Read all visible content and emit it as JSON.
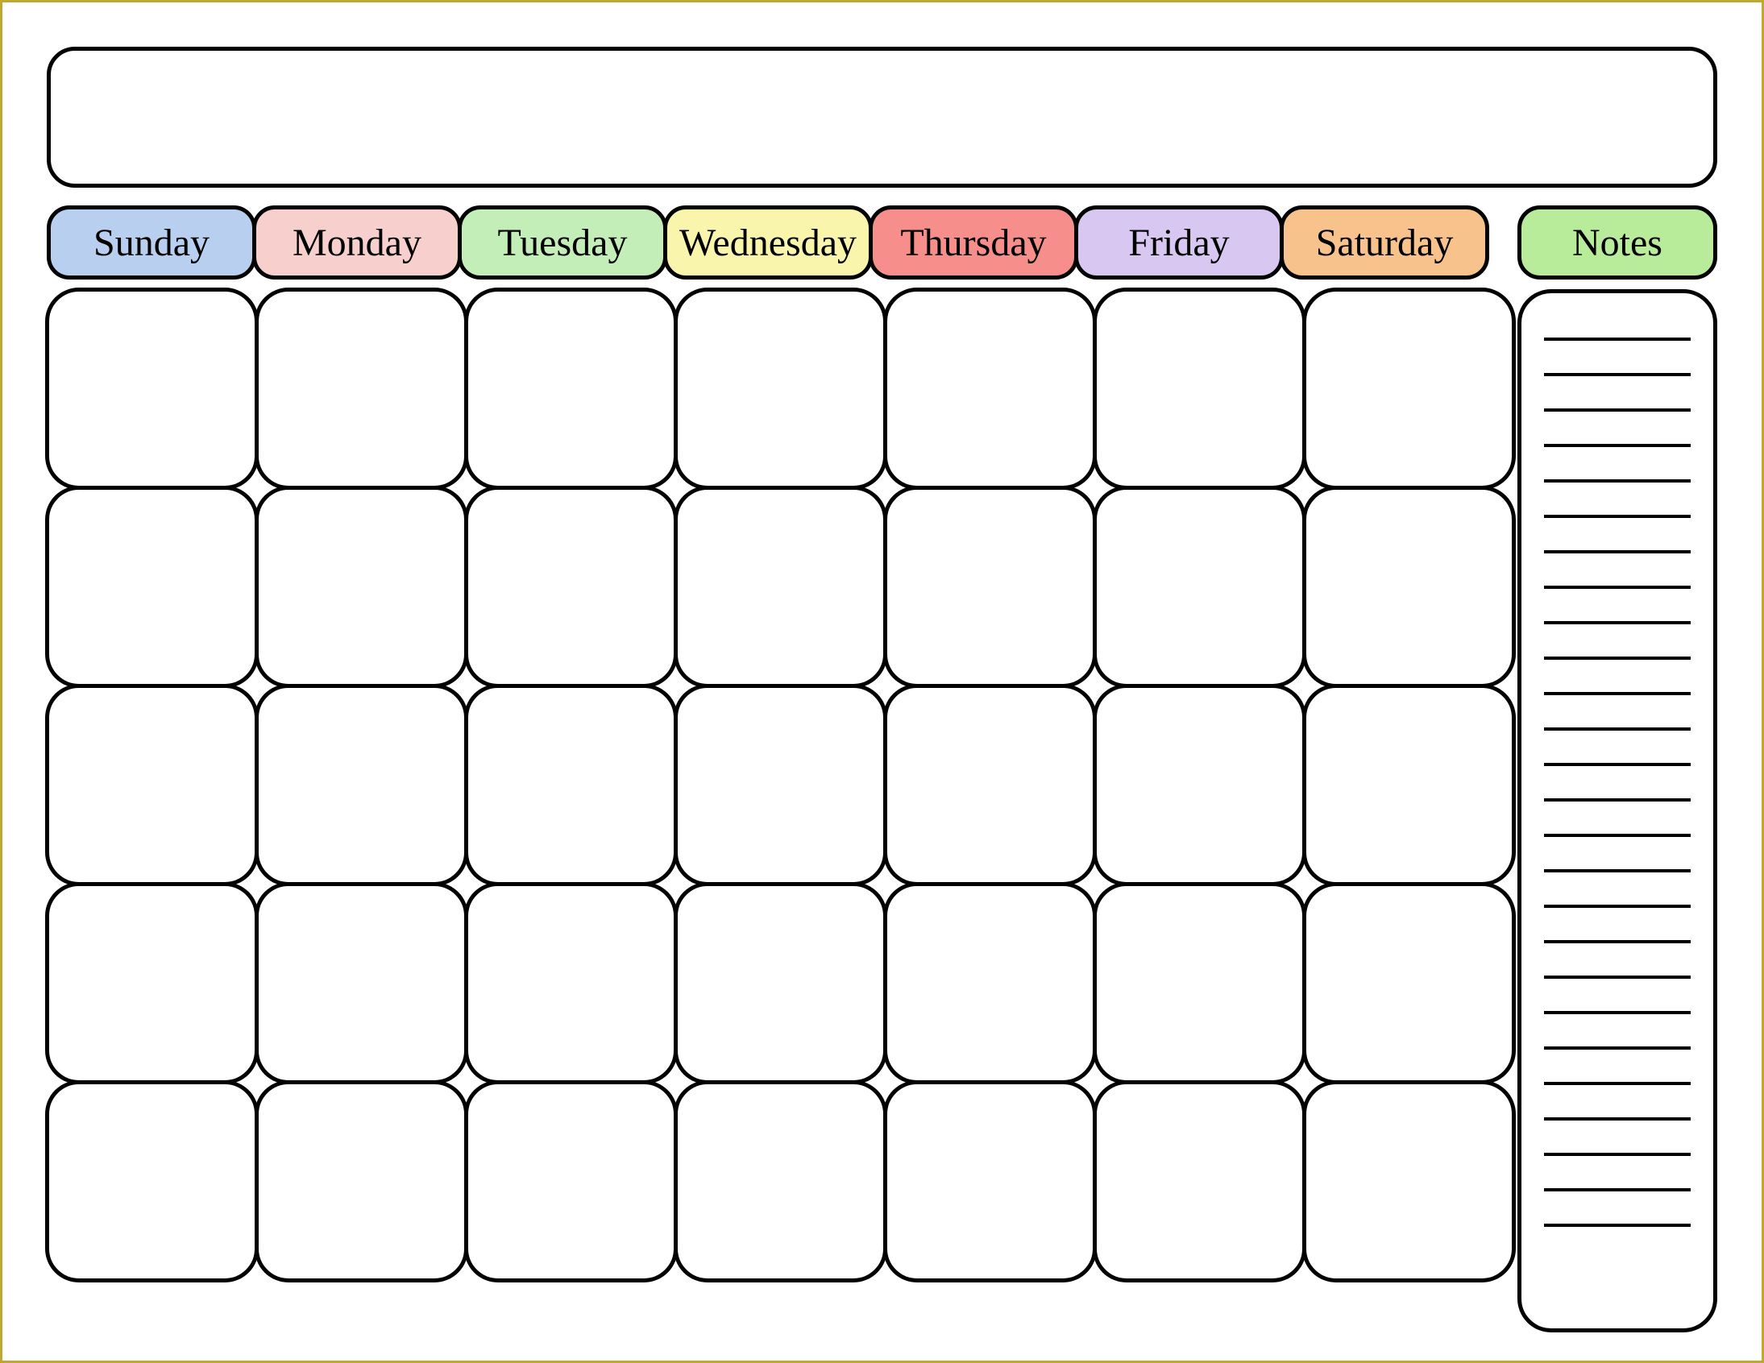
{
  "title": "",
  "headers": [
    {
      "label": "Sunday",
      "color": "#b8cff0"
    },
    {
      "label": "Monday",
      "color": "#f7d0cd"
    },
    {
      "label": "Tuesday",
      "color": "#c3eeb7"
    },
    {
      "label": "Wednesday",
      "color": "#faf5ac"
    },
    {
      "label": "Thursday",
      "color": "#f68e8b"
    },
    {
      "label": "Friday",
      "color": "#d8c7f1"
    },
    {
      "label": "Saturday",
      "color": "#f7c28b"
    }
  ],
  "notes_header": {
    "label": "Notes",
    "color": "#b9ec9a"
  },
  "weeks": 5,
  "days_per_week": 7,
  "note_lines": 26
}
